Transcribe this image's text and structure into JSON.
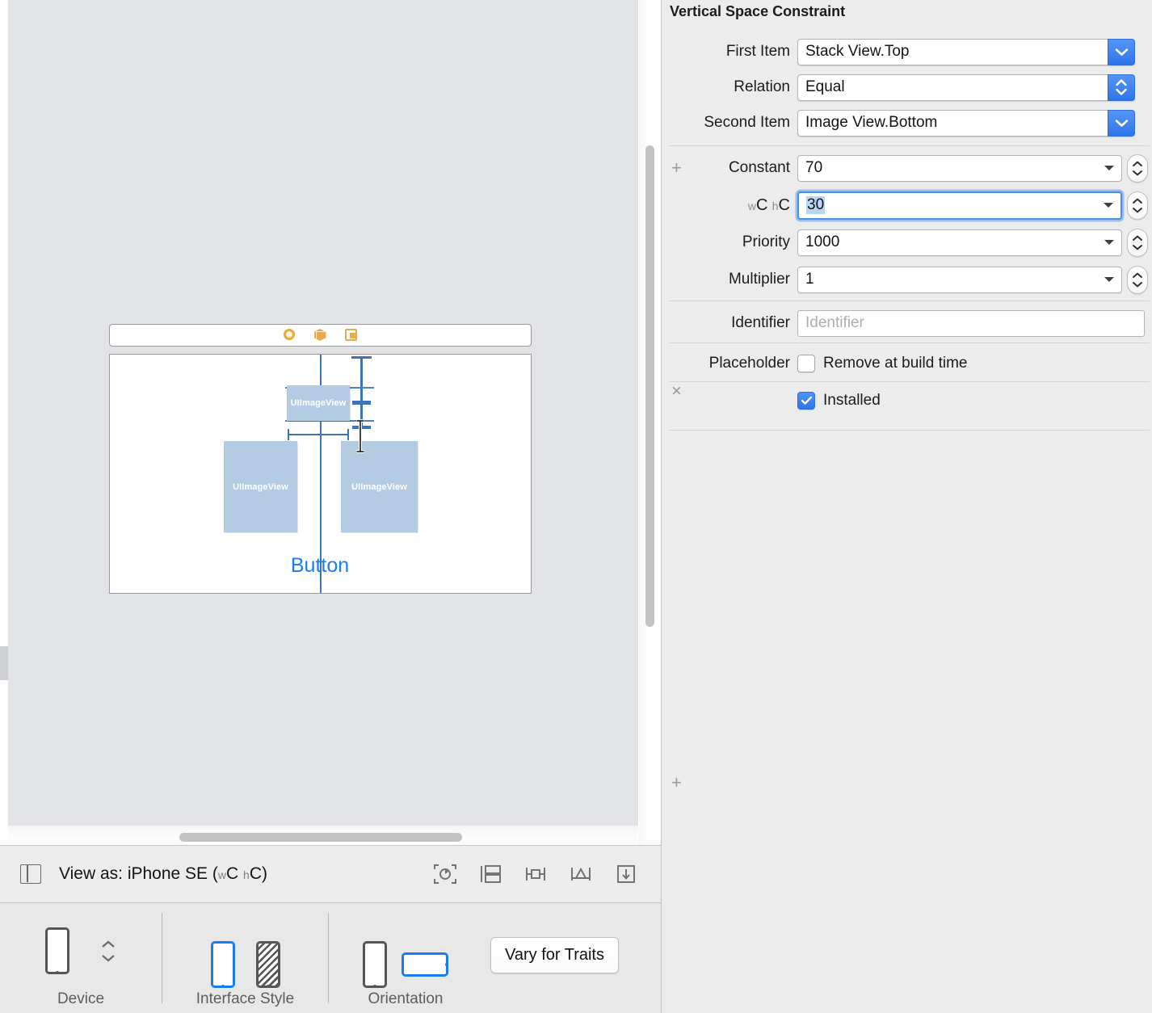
{
  "inspector": {
    "title": "Vertical Space Constraint",
    "rows": {
      "first_item": {
        "label": "First Item",
        "value": "Stack View.Top"
      },
      "relation": {
        "label": "Relation",
        "value": "Equal"
      },
      "second_item": {
        "label": "Second Item",
        "value": "Image View.Bottom"
      },
      "constant": {
        "label": "Constant",
        "value": "70",
        "leading_icon": "+"
      },
      "variation": {
        "width_prefix": "w",
        "width_class": "C",
        "height_prefix": "h",
        "height_class": "C",
        "value": "30",
        "leading_icon": "×"
      },
      "priority": {
        "label": "Priority",
        "value": "1000"
      },
      "multiplier": {
        "label": "Multiplier",
        "value": "1"
      },
      "identifier": {
        "label": "Identifier",
        "placeholder": "Identifier"
      },
      "placeholder": {
        "label": "Placeholder",
        "checkbox_label": "Remove at build time",
        "checked": false
      },
      "installed": {
        "label": "Installed",
        "checked": true,
        "leading_icon": "+"
      }
    }
  },
  "canvas": {
    "scene_icons": [
      "view-controller-icon",
      "first-responder-icon",
      "exit-icon"
    ],
    "views": {
      "top_image": "UIImageView",
      "left_image": "UIImageView",
      "right_image": "UIImageView",
      "button": "Button"
    }
  },
  "bottom_bar": {
    "panel_toggle": "panel-toggle-icon",
    "view_as_prefix": "View as: iPhone SE (",
    "view_as_w": "w",
    "view_as_wc": "C",
    "view_as_h": "h",
    "view_as_hc": "C",
    "view_as_suffix": ")",
    "icons": [
      "update-frames-icon",
      "embed-in-icon",
      "align-icon",
      "add-constraints-icon",
      "resolve-issues-icon"
    ]
  },
  "traits_bar": {
    "device_label": "Device",
    "interface_style_label": "Interface Style",
    "orientation_label": "Orientation",
    "vary_button": "Vary for Traits"
  },
  "colors": {
    "accent_blue": "#2f74ea",
    "button_blue": "#1a7cf4",
    "imageview_fill": "#b4cbe4",
    "constraint_blue": "#3b74b8",
    "scene_icon_orange": "#eda948",
    "panel_bg": "#ececec"
  }
}
